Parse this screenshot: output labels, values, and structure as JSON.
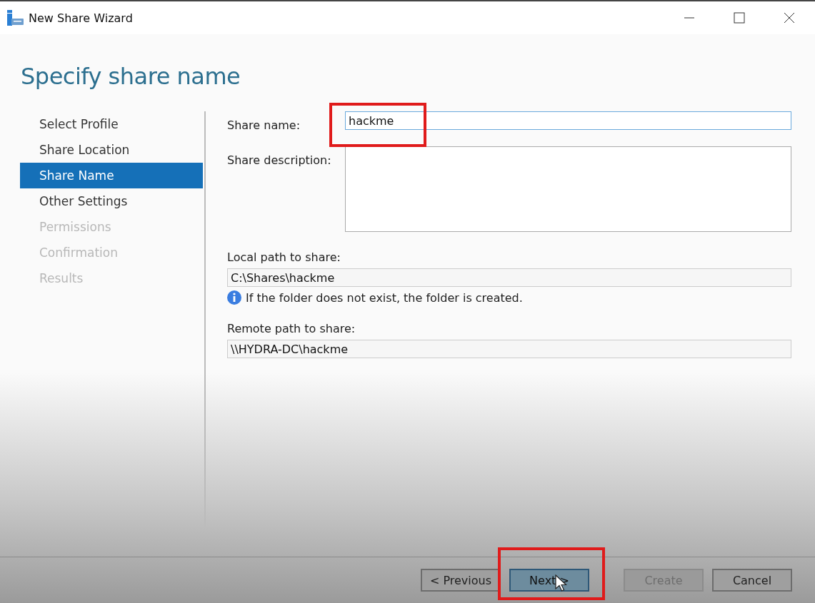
{
  "window": {
    "title": "New Share Wizard"
  },
  "heading": "Specify share name",
  "steps": [
    {
      "label": "Select Profile",
      "selected": false,
      "disabled": false
    },
    {
      "label": "Share Location",
      "selected": false,
      "disabled": false
    },
    {
      "label": "Share Name",
      "selected": true,
      "disabled": false
    },
    {
      "label": "Other Settings",
      "selected": false,
      "disabled": false
    },
    {
      "label": "Permissions",
      "selected": false,
      "disabled": true
    },
    {
      "label": "Confirmation",
      "selected": false,
      "disabled": true
    },
    {
      "label": "Results",
      "selected": false,
      "disabled": true
    }
  ],
  "share_name": {
    "label": "Share name:",
    "value": "hackme",
    "highlighted": true
  },
  "share_description": {
    "label": "Share description:"
  },
  "local_path": {
    "label": "Local path to share:",
    "value": "C:\\Shares\\hackme",
    "info": "If the folder does not exist, the folder is created."
  },
  "remote_path": {
    "label": "Remote path to share:",
    "value": "\\\\HYDRA-DC\\hackme"
  },
  "buttons": [
    {
      "label": "< Previous",
      "kind": "normal",
      "disabled": false,
      "highlighted": false
    },
    {
      "label": "Next >",
      "kind": "default",
      "disabled": false,
      "highlighted": true
    },
    {
      "label": "Create",
      "kind": "normal",
      "disabled": true,
      "highlighted": false
    },
    {
      "label": "Cancel",
      "kind": "normal",
      "disabled": false,
      "highlighted": false
    }
  ]
}
